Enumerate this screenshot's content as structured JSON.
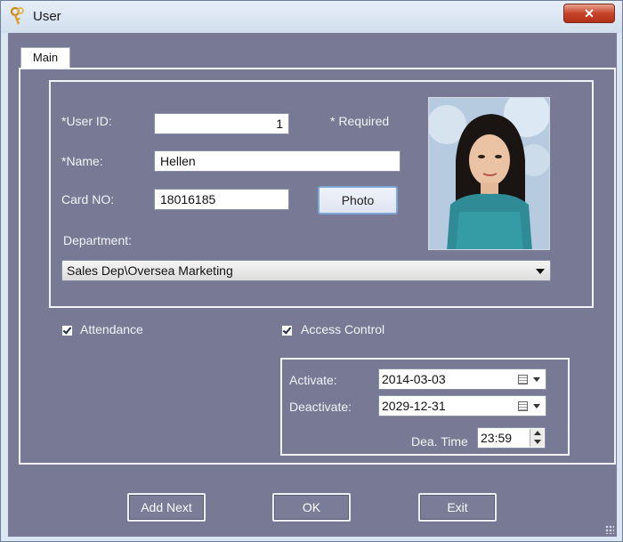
{
  "window": {
    "title": "User",
    "close_label": "✕"
  },
  "tabs": [
    {
      "label": "Main"
    }
  ],
  "form": {
    "user_id_label": "*User ID:",
    "user_id_value": "1",
    "required_note": "* Required",
    "name_label": "*Name:",
    "name_value": "Hellen",
    "card_label": "Card NO:",
    "card_value": "18016185",
    "photo_button": "Photo",
    "department_label": "Department:",
    "department_value": "Sales Dep\\Oversea Marketing"
  },
  "options": {
    "attendance_label": "Attendance",
    "attendance_checked": true,
    "access_label": "Access Control",
    "access_checked": true
  },
  "access": {
    "activate_label": "Activate:",
    "activate_value": "2014-03-03",
    "deactivate_label": "Deactivate:",
    "deactivate_value": "2029-12-31",
    "dea_time_label": "Dea. Time",
    "dea_time_value": "23:59"
  },
  "buttons": {
    "add_next": "Add Next",
    "ok": "OK",
    "exit": "Exit"
  },
  "colors": {
    "client_bg": "#787a95",
    "title_bg": "#dbe6f3",
    "close_red": "#c7442a",
    "photo_border": "#7ea6d8"
  },
  "icons": {
    "app": "keys-icon",
    "calendar": "calendar-icon"
  }
}
